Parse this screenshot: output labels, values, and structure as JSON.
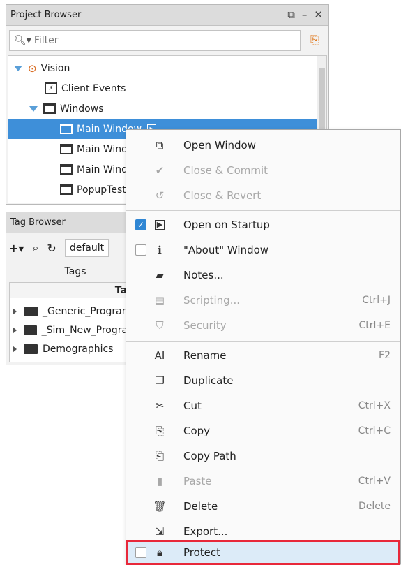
{
  "project_browser": {
    "title": "Project Browser",
    "filter_placeholder": "Filter",
    "tree": [
      {
        "label": "Vision"
      },
      {
        "label": "Client Events"
      },
      {
        "label": "Windows"
      },
      {
        "label": "Main Window"
      },
      {
        "label": "Main Windo"
      },
      {
        "label": "Main Windo"
      },
      {
        "label": "PopupTest"
      }
    ]
  },
  "tag_browser": {
    "title": "Tag Browser",
    "provider": "default",
    "tab_label": "Tags",
    "column_header": "Tag",
    "folders": [
      {
        "label": "_Generic_Programs"
      },
      {
        "label": "_Sim_New_Programs"
      },
      {
        "label": "Demographics"
      }
    ]
  },
  "context_menu": {
    "items": [
      {
        "label": "Open Window",
        "shortcut": "",
        "icon": "open-window-icon",
        "disabled": false
      },
      {
        "label": "Close & Commit",
        "shortcut": "",
        "icon": "check-circle-icon",
        "disabled": true
      },
      {
        "label": "Close & Revert",
        "shortcut": "",
        "icon": "revert-icon",
        "disabled": true
      },
      {
        "label": "Open on Startup",
        "shortcut": "",
        "icon": "play-box-icon",
        "disabled": false,
        "checked": true
      },
      {
        "label": "\"About\" Window",
        "shortcut": "",
        "icon": "info-icon",
        "disabled": false,
        "checked": false
      },
      {
        "label": "Notes...",
        "shortcut": "",
        "icon": "note-icon",
        "disabled": false
      },
      {
        "label": "Scripting...",
        "shortcut": "Ctrl+J",
        "icon": "script-icon",
        "disabled": true
      },
      {
        "label": "Security",
        "shortcut": "Ctrl+E",
        "icon": "shield-icon",
        "disabled": true
      },
      {
        "label": "Rename",
        "shortcut": "F2",
        "icon": "rename-icon",
        "disabled": false
      },
      {
        "label": "Duplicate",
        "shortcut": "",
        "icon": "duplicate-icon",
        "disabled": false
      },
      {
        "label": "Cut",
        "shortcut": "Ctrl+X",
        "icon": "scissors-icon",
        "disabled": false
      },
      {
        "label": "Copy",
        "shortcut": "Ctrl+C",
        "icon": "copy-icon",
        "disabled": false
      },
      {
        "label": "Copy Path",
        "shortcut": "",
        "icon": "copy-path-icon",
        "disabled": false
      },
      {
        "label": "Paste",
        "shortcut": "Ctrl+V",
        "icon": "paste-icon",
        "disabled": true
      },
      {
        "label": "Delete",
        "shortcut": "Delete",
        "icon": "trash-icon",
        "disabled": false
      },
      {
        "label": "Export...",
        "shortcut": "",
        "icon": "export-icon",
        "disabled": false
      },
      {
        "label": "Protect",
        "shortcut": "",
        "icon": "lock-icon",
        "disabled": false,
        "checked": false,
        "highlighted": true
      }
    ]
  },
  "colors": {
    "selection": "#3e8fd9",
    "highlight_border": "#e8283a",
    "checkbox_on": "#2f86d4"
  }
}
